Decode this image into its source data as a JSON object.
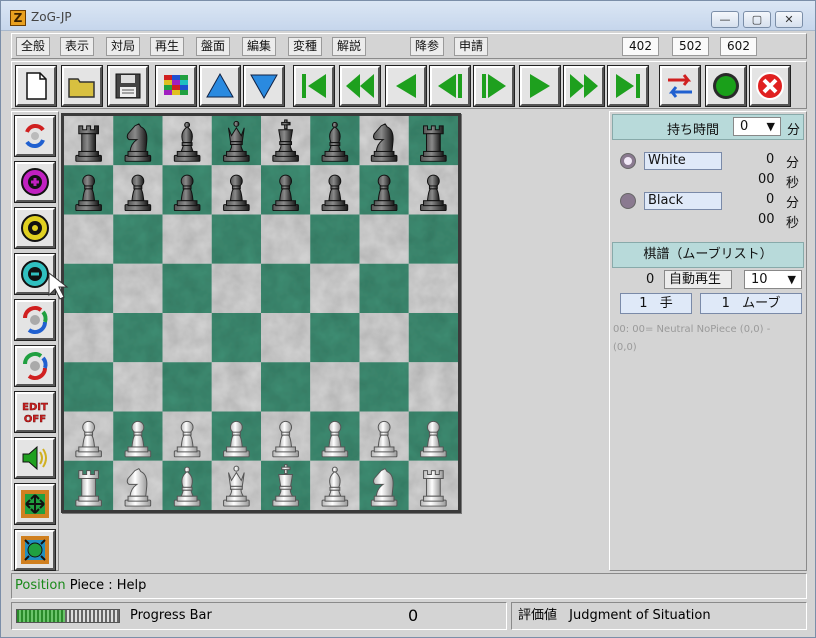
{
  "window": {
    "title": "ZoG-JP",
    "app_icon_letter": "Z",
    "minimize_glyph": "—",
    "maximize_glyph": "▢",
    "close_glyph": "✕"
  },
  "menu": {
    "items": [
      "全般",
      "表示",
      "対局",
      "再生",
      "盤面",
      "編集",
      "変種",
      "解説",
      "降参",
      "申請"
    ],
    "counters": [
      "402",
      "502",
      "602"
    ]
  },
  "toolbar": {
    "buttons": [
      {
        "name": "new-game-button",
        "icon": "document-icon"
      },
      {
        "name": "open-button",
        "icon": "folder-icon"
      },
      {
        "name": "save-button",
        "icon": "floppy-icon"
      },
      {
        "name": "board-style-button",
        "icon": "grid-icon"
      },
      {
        "name": "move-up-button",
        "icon": "triangle-up-icon"
      },
      {
        "name": "move-down-button",
        "icon": "triangle-down-icon"
      },
      {
        "name": "first-move-button",
        "icon": "skip-first-icon"
      },
      {
        "name": "fast-back-button",
        "icon": "fast-back-icon"
      },
      {
        "name": "back-button",
        "icon": "back-icon"
      },
      {
        "name": "step-back-button",
        "icon": "step-back-icon"
      },
      {
        "name": "step-forward-button",
        "icon": "step-forward-icon"
      },
      {
        "name": "forward-button",
        "icon": "forward-icon"
      },
      {
        "name": "fast-forward-button",
        "icon": "fast-forward-icon"
      },
      {
        "name": "last-move-button",
        "icon": "skip-last-icon"
      },
      {
        "name": "switch-sides-button",
        "icon": "switch-icon"
      },
      {
        "name": "go-button",
        "icon": "green-circle-icon"
      },
      {
        "name": "stop-button",
        "icon": "red-x-icon"
      }
    ]
  },
  "sidebar": {
    "edit_label_1": "EDIT",
    "edit_label_2": "OFF"
  },
  "board": {
    "rows": [
      [
        "r",
        "n",
        "b",
        "q",
        "k",
        "b",
        "n",
        "r"
      ],
      [
        "p",
        "p",
        "p",
        "p",
        "p",
        "p",
        "p",
        "p"
      ],
      [
        "",
        "",
        "",
        "",
        "",
        "",
        "",
        ""
      ],
      [
        "",
        "",
        "",
        "",
        "",
        "",
        "",
        ""
      ],
      [
        "",
        "",
        "",
        "",
        "",
        "",
        "",
        ""
      ],
      [
        "",
        "",
        "",
        "",
        "",
        "",
        "",
        ""
      ],
      [
        "P",
        "P",
        "P",
        "P",
        "P",
        "P",
        "P",
        "P"
      ],
      [
        "R",
        "N",
        "B",
        "Q",
        "K",
        "B",
        "N",
        "R"
      ]
    ],
    "colors": {
      "light": "#d6d6d6",
      "dark": "#3f8f74"
    }
  },
  "time_panel": {
    "header": "持ち時間",
    "time_select": "0",
    "unit": "分",
    "white_name": "White",
    "black_name": "Black",
    "white_min": "0",
    "white_min_unit": "分",
    "white_sec": "00",
    "white_sec_unit": "秒",
    "black_min": "0",
    "black_min_unit": "分",
    "black_sec": "00",
    "black_sec_unit": "秒"
  },
  "movelist_panel": {
    "header": "棋譜（ムーブリスト）",
    "count": "0",
    "autoplay_label": "自動再生",
    "speed_select": "10",
    "move_number": "1",
    "move_unit": "手",
    "ply_number": "1",
    "ply_unit": "ムーブ",
    "entries": [
      "00: 00= Neutral NoPiece (0,0) - (0,0)"
    ]
  },
  "status": {
    "position_label": "Position",
    "position_text": "Piece : Help",
    "progress_label": "Progress Bar",
    "progress_value": "0",
    "eval_label": "評価値",
    "eval_text": "Judgment of Situation"
  }
}
